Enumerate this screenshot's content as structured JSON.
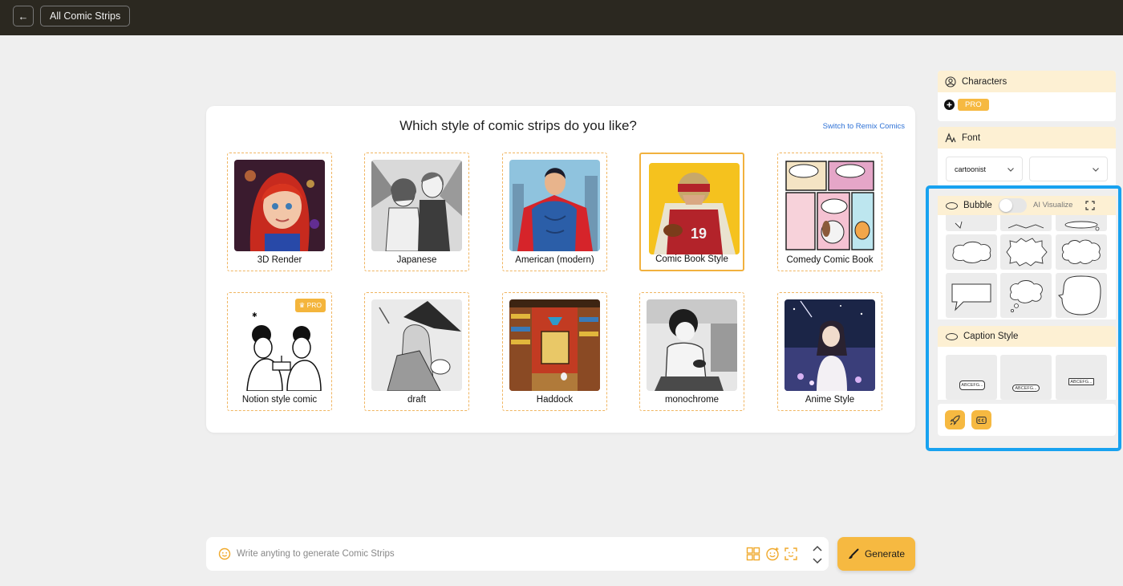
{
  "topbar": {
    "back_icon": "←",
    "breadcrumb": "All Comic Strips"
  },
  "main": {
    "title": "Which style of comic strips do you like?",
    "remix_link": "Switch to Remix Comics",
    "selected_style": "Comic Book Style",
    "styles": [
      {
        "label": "3D Render"
      },
      {
        "label": "Japanese"
      },
      {
        "label": "American (modern)"
      },
      {
        "label": "Comic Book Style"
      },
      {
        "label": "Comedy Comic Book"
      },
      {
        "label": "Notion style comic",
        "badge": "PRO"
      },
      {
        "label": "draft"
      },
      {
        "label": "Haddock"
      },
      {
        "label": "monochrome"
      },
      {
        "label": "Anime Style"
      }
    ]
  },
  "prompt": {
    "placeholder": "Write anyting to generate Comic Strips",
    "generate_label": "Generate"
  },
  "sidebar": {
    "characters": {
      "title": "Characters",
      "pro_label": "PRO"
    },
    "font": {
      "title": "Font",
      "font_value": "cartoonist",
      "size_value": ""
    },
    "bubble": {
      "title": "Bubble",
      "ai_visualize": "AI Visualize"
    },
    "caption": {
      "title": "Caption Style",
      "samples": [
        "ABCEFG...",
        "ABCEFG...",
        "ABCEFG..."
      ]
    }
  },
  "colors": {
    "accent": "#f6b941",
    "highlight": "#18a2f0",
    "topbar": "#2b2820"
  }
}
